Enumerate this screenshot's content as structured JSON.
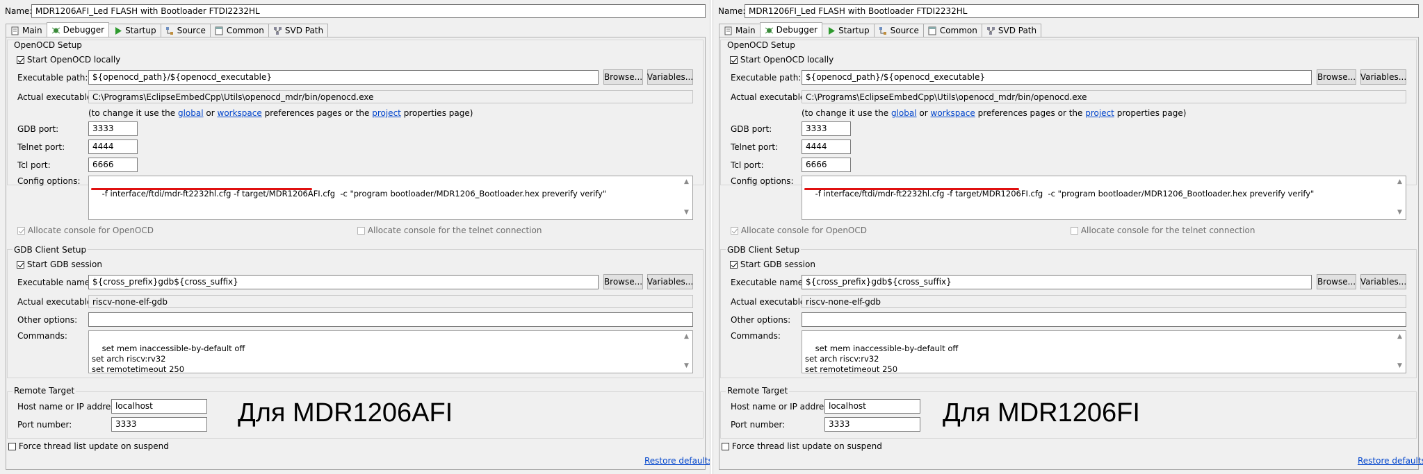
{
  "panels": [
    {
      "name_label": "Name:",
      "name_value": "MDR1206AFI_Led FLASH with Bootloader FTDI2232HL",
      "tabs": [
        {
          "label": "Main",
          "icon": "main-icon"
        },
        {
          "label": "Debugger",
          "icon": "debugger-icon",
          "active": true
        },
        {
          "label": "Startup",
          "icon": "startup-icon"
        },
        {
          "label": "Source",
          "icon": "source-icon"
        },
        {
          "label": "Common",
          "icon": "common-icon"
        },
        {
          "label": "SVD Path",
          "icon": "svd-path-icon"
        }
      ],
      "openocd": {
        "title": "OpenOCD Setup",
        "start_locally": "Start OpenOCD locally",
        "exec_path_label": "Executable path:",
        "exec_path_value": "${openocd_path}/${openocd_executable}",
        "browse": "Browse...",
        "variables": "Variables...",
        "actual_exec_label": "Actual executable:",
        "actual_exec_value": "C:\\Programs\\EclipseEmbedCpp\\Utils\\openocd_mdr/bin/openocd.exe",
        "note_prefix": "(to change it use the",
        "note_global": "global",
        "note_or": "or",
        "note_workspace": "workspace",
        "note_middle": "preferences pages or the",
        "note_project": "project",
        "note_suffix": "properties page)",
        "gdb_port_label": "GDB port:",
        "gdb_port_value": "3333",
        "telnet_port_label": "Telnet port:",
        "telnet_port_value": "4444",
        "tcl_port_label": "Tcl port:",
        "tcl_port_value": "6666",
        "config_label": "Config options:",
        "config_value": "-f interface/ftdi/mdr-ft2232hl.cfg -f target/MDR1206AFI.cfg  -c \"program bootloader/MDR1206_Bootloader.hex preverify verify\"",
        "alloc_openocd": "Allocate console for OpenOCD",
        "alloc_telnet": "Allocate console for the telnet connection"
      },
      "gdb": {
        "title": "GDB Client Setup",
        "start_session": "Start GDB session",
        "exec_name_label": "Executable name:",
        "exec_name_value": "${cross_prefix}gdb${cross_suffix}",
        "browse": "Browse...",
        "variables": "Variables...",
        "actual_exec_label": "Actual executable:",
        "actual_exec_value": "riscv-none-elf-gdb",
        "other_options_label": "Other options:",
        "other_options_value": "",
        "commands_label": "Commands:",
        "commands_value": "set mem inaccessible-by-default off\nset arch riscv:rv32\nset remotetimeout 250"
      },
      "remote": {
        "title": "Remote Target",
        "host_label": "Host name or IP address:",
        "host_value": "localhost",
        "port_label": "Port number:",
        "port_value": "3333"
      },
      "caption": "Для MDR1206AFI",
      "force_thread": "Force thread list update on suspend",
      "restore_defaults": "Restore defaults"
    },
    {
      "name_label": "Name:",
      "name_value": "MDR1206FI_Led FLASH with Bootloader FTDI2232HL",
      "tabs": [
        {
          "label": "Main",
          "icon": "main-icon"
        },
        {
          "label": "Debugger",
          "icon": "debugger-icon",
          "active": true
        },
        {
          "label": "Startup",
          "icon": "startup-icon"
        },
        {
          "label": "Source",
          "icon": "source-icon"
        },
        {
          "label": "Common",
          "icon": "common-icon"
        },
        {
          "label": "SVD Path",
          "icon": "svd-path-icon"
        }
      ],
      "openocd": {
        "title": "OpenOCD Setup",
        "start_locally": "Start OpenOCD locally",
        "exec_path_label": "Executable path:",
        "exec_path_value": "${openocd_path}/${openocd_executable}",
        "browse": "Browse...",
        "variables": "Variables...",
        "actual_exec_label": "Actual executable:",
        "actual_exec_value": "C:\\Programs\\EclipseEmbedCpp\\Utils\\openocd_mdr/bin/openocd.exe",
        "note_prefix": "(to change it use the",
        "note_global": "global",
        "note_or": "or",
        "note_workspace": "workspace",
        "note_middle": "preferences pages or the",
        "note_project": "project",
        "note_suffix": "properties page)",
        "gdb_port_label": "GDB port:",
        "gdb_port_value": "3333",
        "telnet_port_label": "Telnet port:",
        "telnet_port_value": "4444",
        "tcl_port_label": "Tcl port:",
        "tcl_port_value": "6666",
        "config_label": "Config options:",
        "config_value": "-f interface/ftdi/mdr-ft2232hl.cfg -f target/MDR1206FI.cfg  -c \"program bootloader/MDR1206_Bootloader.hex preverify verify\"",
        "alloc_openocd": "Allocate console for OpenOCD",
        "alloc_telnet": "Allocate console for the telnet connection"
      },
      "gdb": {
        "title": "GDB Client Setup",
        "start_session": "Start GDB session",
        "exec_name_label": "Executable name:",
        "exec_name_value": "${cross_prefix}gdb${cross_suffix}",
        "browse": "Browse...",
        "variables": "Variables...",
        "actual_exec_label": "Actual executable:",
        "actual_exec_value": "riscv-none-elf-gdb",
        "other_options_label": "Other options:",
        "other_options_value": "",
        "commands_label": "Commands:",
        "commands_value": "set mem inaccessible-by-default off\nset arch riscv:rv32\nset remotetimeout 250"
      },
      "remote": {
        "title": "Remote Target",
        "host_label": "Host name or IP address:",
        "host_value": "localhost",
        "port_label": "Port number:",
        "port_value": "3333"
      },
      "caption": "Для MDR1206FI",
      "force_thread": "Force thread list update on suspend",
      "restore_defaults": "Restore defaults"
    }
  ],
  "colors": {
    "underline_highlight": "#e01010",
    "link": "#0044cc",
    "dialog_bg": "#f0f0f0"
  }
}
